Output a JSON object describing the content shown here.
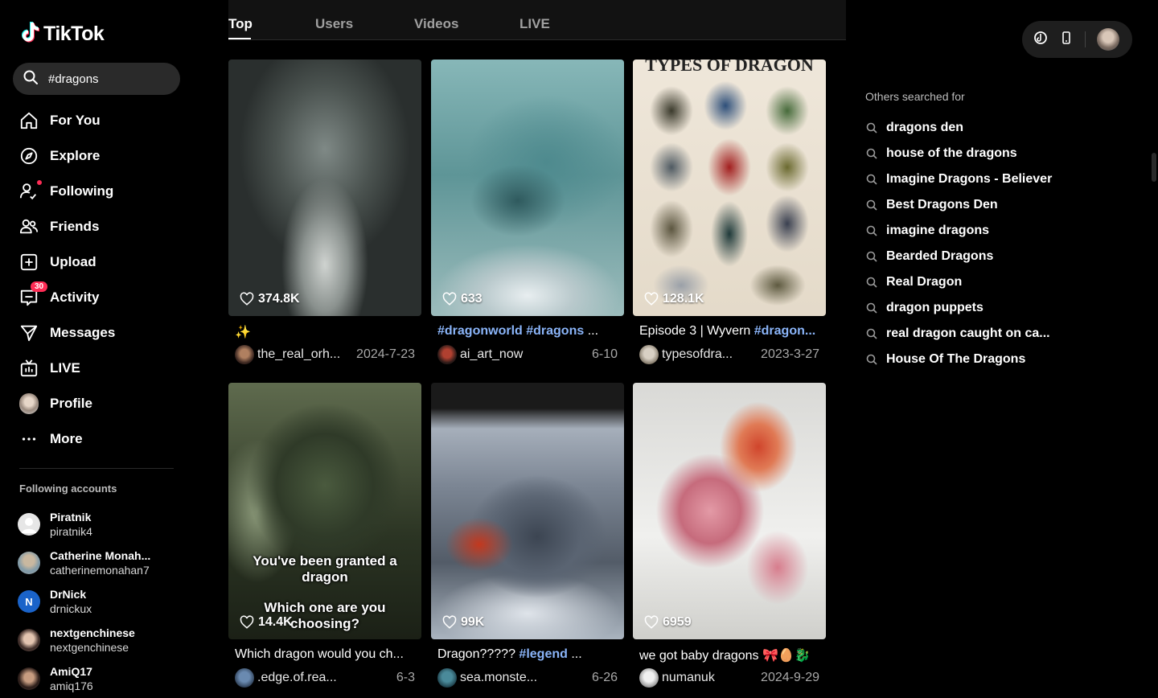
{
  "app": {
    "brand": "TikTok"
  },
  "search": {
    "value": "#dragons",
    "placeholder": "Search"
  },
  "nav": {
    "items": [
      {
        "label": "For You",
        "icon": "home-icon"
      },
      {
        "label": "Explore",
        "icon": "compass-icon"
      },
      {
        "label": "Following",
        "icon": "following-icon"
      },
      {
        "label": "Friends",
        "icon": "friends-icon"
      },
      {
        "label": "Upload",
        "icon": "upload-icon"
      },
      {
        "label": "Activity",
        "icon": "activity-icon",
        "badge": "30"
      },
      {
        "label": "Messages",
        "icon": "messages-icon"
      },
      {
        "label": "LIVE",
        "icon": "live-icon"
      },
      {
        "label": "Profile",
        "icon": "avatar"
      },
      {
        "label": "More",
        "icon": "more-icon"
      }
    ]
  },
  "following": {
    "title": "Following accounts",
    "accounts": [
      {
        "name": "Piratnik",
        "handle": "piratnik4"
      },
      {
        "name": "Catherine Monah...",
        "handle": "catherinemonahan7"
      },
      {
        "name": "DrNick",
        "handle": "drnickux",
        "initial": "N"
      },
      {
        "name": "nextgenchinese",
        "handle": "nextgenchinese"
      },
      {
        "name": "AmiQ17",
        "handle": "amiq176"
      }
    ]
  },
  "tabs": [
    {
      "label": "Top",
      "active": true
    },
    {
      "label": "Users",
      "active": false
    },
    {
      "label": "Videos",
      "active": false
    },
    {
      "label": "LIVE",
      "active": false
    }
  ],
  "videos": [
    {
      "likes": "374.8K",
      "caption": "✨",
      "user": "the_real_orh...",
      "date": "2024-7-23"
    },
    {
      "likes": "633",
      "caption_tags": "#dragonworld #dragons",
      "caption_tail": " ...",
      "user": "ai_art_now",
      "date": "6-10"
    },
    {
      "likes": "128.1K",
      "caption": "Episode 3 | Wyvern ",
      "caption_tag": "#dragon...",
      "user": "typesofdra...",
      "date": "2023-3-27",
      "poster_title": "TYPES OF DRAGON"
    },
    {
      "likes": "14.4K",
      "caption": "Which dragon would you ch...",
      "user": ".edge.of.rea...",
      "date": "6-3",
      "overlay_line1": "You've been granted a dragon",
      "overlay_line2": "Which one are you choosing?"
    },
    {
      "likes": "99K",
      "caption": "Dragon????? ",
      "caption_tag": "#legend",
      "caption_tail": " ...",
      "user": "sea.monste...",
      "date": "6-26"
    },
    {
      "likes": "6959",
      "caption": "we got baby dragons 🎀🥚🐉",
      "user": "numanuk",
      "date": "2024-9-29"
    }
  ],
  "right": {
    "others_title": "Others searched for",
    "suggestions": [
      "dragons den",
      "house of the dragons",
      "Imagine Dragons - Believer",
      "Best Dragons Den",
      "imagine dragons",
      "Bearded Dragons",
      "Real Dragon",
      "dragon puppets",
      "real dragon caught on ca...",
      "House Of The Dragons"
    ]
  }
}
